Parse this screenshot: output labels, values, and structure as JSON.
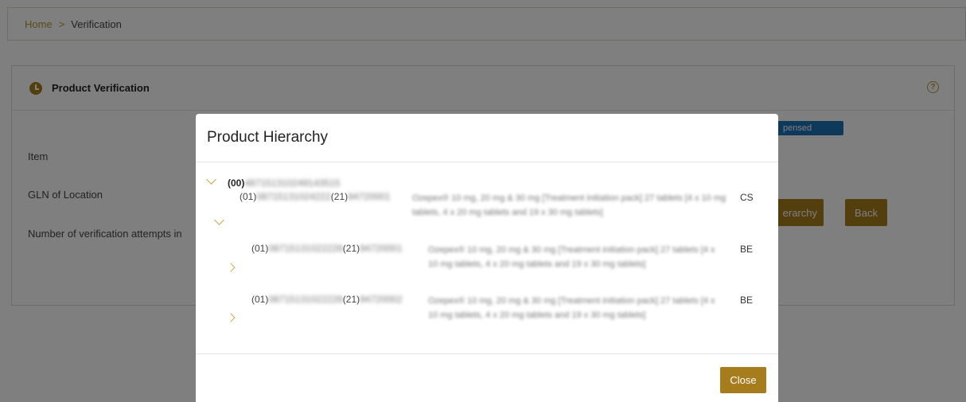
{
  "breadcrumb": {
    "home": "Home",
    "separator": ">",
    "current": "Verification"
  },
  "card": {
    "title": "Product Verification",
    "help_icon": "?"
  },
  "fields": {
    "item_label": "Item",
    "gln_label": "GLN of Location",
    "attempts_label": "Number of verification attempts in"
  },
  "status_badge": "pensed",
  "buttons": {
    "hierarchy": "erarchy",
    "back": "Back",
    "close": "Close"
  },
  "modal": {
    "title": "Product Hierarchy",
    "root": {
      "prefix": "(00)",
      "code": "487151310249143515"
    },
    "rows": [
      {
        "ai1": "(01)",
        "gtin": "08715131024222",
        "ai2": "(21)",
        "serial": "94720001",
        "description": "Ozepex® 10 mg, 20 mg & 30 mg [Treatment initiation pack] 27 tablets [4 x 10 mg tablets, 4 x 20 mg tablets and 19 x 30 mg tablets]",
        "packaging": "CS"
      },
      {
        "ai1": "(01)",
        "gtin": "08715131022228",
        "ai2": "(21)",
        "serial": "94720001",
        "description": "Ozepex® 10 mg, 20 mg & 30 mg [Treatment initiation pack] 27 tablets [4 x 10 mg tablets, 4 x 20 mg tablets and 19 x 30 mg tablets]",
        "packaging": "BE"
      },
      {
        "ai1": "(01)",
        "gtin": "08715131022228",
        "ai2": "(21)",
        "serial": "94720002",
        "description": "Ozepex® 10 mg, 20 mg & 30 mg [Treatment initiation pack] 27 tablets [4 x 10 mg tablets, 4 x 20 mg tablets and 19 x 30 mg tablets]",
        "packaging": "BE"
      }
    ]
  },
  "colors": {
    "accent": "#a67c1d",
    "badge": "#1f73b7"
  }
}
